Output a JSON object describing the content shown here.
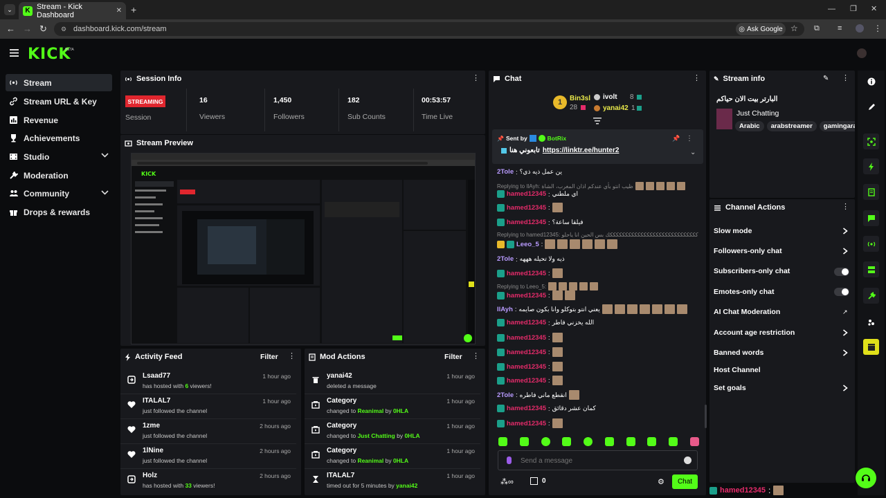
{
  "browser": {
    "tab_title": "Stream - Kick Dashboard",
    "url": "dashboard.kick.com/stream",
    "ask_google": "Ask Google"
  },
  "brand": {
    "logo": "KICK",
    "beta": "BETA",
    "accent": "#53fc18"
  },
  "sidebar": {
    "items": [
      {
        "label": "Stream",
        "icon": "broadcast-icon"
      },
      {
        "label": "Stream URL & Key",
        "icon": "link-icon"
      },
      {
        "label": "Revenue",
        "icon": "chart-icon"
      },
      {
        "label": "Achievements",
        "icon": "trophy-icon"
      },
      {
        "label": "Studio",
        "icon": "film-icon"
      },
      {
        "label": "Moderation",
        "icon": "wrench-icon"
      },
      {
        "label": "Community",
        "icon": "people-icon"
      },
      {
        "label": "Drops & rewards",
        "icon": "gift-icon"
      }
    ]
  },
  "session": {
    "title": "Session Info",
    "status": "STREAMING",
    "status_label": "Session",
    "viewers": "16",
    "viewers_label": "Viewers",
    "followers": "1,450",
    "followers_label": "Followers",
    "subs": "182",
    "subs_label": "Sub Counts",
    "time": "00:53:57",
    "time_label": "Time Live"
  },
  "preview": {
    "title": "Stream Preview"
  },
  "activity": {
    "title": "Activity Feed",
    "filter": "Filter",
    "rows": [
      {
        "name": "Lsaad77",
        "pre": "has hosted with ",
        "hl": "6",
        "post": " viewers!",
        "time": "1 hour ago",
        "icon": "host-icon"
      },
      {
        "name": "ITALAL7",
        "pre": "just followed the channel",
        "hl": "",
        "post": "",
        "time": "1 hour ago",
        "icon": "heart-icon"
      },
      {
        "name": "1zme",
        "pre": "just followed the channel",
        "hl": "",
        "post": "",
        "time": "2 hours ago",
        "icon": "heart-icon"
      },
      {
        "name": "1lNine",
        "pre": "just followed the channel",
        "hl": "",
        "post": "",
        "time": "2 hours ago",
        "icon": "heart-icon"
      },
      {
        "name": "Holz",
        "pre": "has hosted with ",
        "hl": "33",
        "post": " viewers!",
        "time": "2 hours ago",
        "icon": "host-icon"
      }
    ]
  },
  "mod": {
    "title": "Mod Actions",
    "filter": "Filter",
    "rows": [
      {
        "name": "yanai42",
        "line": "deleted a message",
        "time": "1 hour ago",
        "icon": "trash-icon"
      },
      {
        "name": "Category",
        "pre": "changed to ",
        "hl": "Reanimal",
        "mid": " by ",
        "hl2": "0HLA",
        "time": "1 hour ago",
        "icon": "category-icon"
      },
      {
        "name": "Category",
        "pre": "changed to ",
        "hl": "Just Chatting",
        "mid": " by ",
        "hl2": "0HLA",
        "time": "1 hour ago",
        "icon": "category-icon"
      },
      {
        "name": "Category",
        "pre": "changed to ",
        "hl": "Reanimal",
        "mid": " by ",
        "hl2": "0HLA",
        "time": "1 hour ago",
        "icon": "category-icon"
      },
      {
        "name": "ITALAL7",
        "pre": "timed out for 5 minutes by ",
        "hl": "yanai42",
        "mid": "",
        "hl2": "",
        "time": "1 hour ago",
        "icon": "hourglass-icon"
      }
    ]
  },
  "chat": {
    "title": "Chat",
    "leaders": [
      {
        "name": "Bin3sl",
        "count": "28"
      },
      {
        "name": "ivolt",
        "count": "8"
      },
      {
        "name": "yanai42",
        "count": "1"
      }
    ],
    "rank": "1",
    "pinned": {
      "sent_by": "Sent by",
      "bot": "BotRix",
      "text": "تابعوني هنا",
      "link": "https://linktr.ee/hunter2"
    },
    "messages": [
      {
        "user": "2Tole",
        "text": "ين عمل ذيه ذي؟"
      },
      {
        "reply": "Replying to IlAyh: ظيب انتو بأي عندكم اذان المغرب، الشاة"
      },
      {
        "user": "hamed12345",
        "text": "اي ملطني"
      },
      {
        "user": "hamed12345",
        "text": ""
      },
      {
        "user": "hamed12345",
        "text": "فيلقا ساعة؟"
      },
      {
        "reply": "Replying to hamed12345: كككككككككككككككككككككككككككككك بس الحين انا ياحلو"
      },
      {
        "user": "Leeo_5",
        "text": ""
      },
      {
        "user": "2Tole",
        "text": "ذيه ولا تحيله هههه"
      },
      {
        "user": "hamed12345",
        "text": ""
      },
      {
        "reply": "Replying to Leeo_5:"
      },
      {
        "user": "hamed12345",
        "text": ""
      },
      {
        "user": "IlAyh",
        "text": "يعني انتو بتوكلو وانا بكون صايمه"
      },
      {
        "user": "hamed12345",
        "text": "الله يخزني فاطر"
      },
      {
        "user": "hamed12345",
        "text": ""
      },
      {
        "user": "hamed12345",
        "text": ""
      },
      {
        "user": "hamed12345",
        "text": ""
      },
      {
        "user": "hamed12345",
        "text": ""
      },
      {
        "user": "2Tole",
        "text": "انقطع ماني فاطره"
      },
      {
        "user": "hamed12345",
        "text": "كمان عشر دقائق"
      },
      {
        "user": "hamed12345",
        "text": ""
      }
    ],
    "placeholder": "Send a message",
    "points": "0",
    "send": "Chat"
  },
  "streaminfo": {
    "title": "Stream info",
    "stream_title": "البارتر بيت الان حياكم",
    "category": "Just Chatting",
    "tags": [
      "Arabic",
      "arabstreamer",
      "gamingarab"
    ]
  },
  "actions": {
    "title": "Channel Actions",
    "items": [
      "Slow mode",
      "Followers-only chat",
      "Subscribers-only chat",
      "Emotes-only chat",
      "AI Chat Moderation",
      "Account age restriction",
      "Banned words",
      "Host Channel",
      "Set goals"
    ]
  },
  "footer": {
    "user": "hamed12345"
  }
}
